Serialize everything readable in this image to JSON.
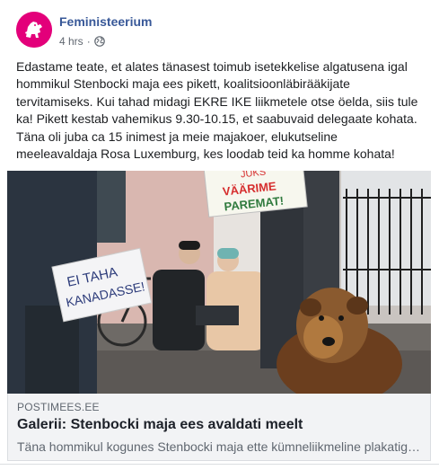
{
  "post": {
    "page_name": "Feministeerium",
    "time": "4 hrs",
    "separator": "·",
    "privacy_icon": "globe-icon",
    "text": "Edastame teate, et alates tänasest toimub isetekkelise algatusena igal hommikul Stenbocki maja ees pikett, koalitsioonläbirääkijate tervitamiseks. Kui tahad midagi EKRE IKE liikmetele otse öelda, siis tule ka! Pikett kestab vahemikus 9.30-10.15, et saabuvaid delegaate kohata. Täna oli juba ca 15 inimest ja meie majakoer, elukutseline meeleavaldaja Rosa Luxemburg, kes loodab teid ka homme kohata!"
  },
  "photo": {
    "sign_left": [
      "EI TAHA",
      "KANADASSE!"
    ],
    "sign_top": [
      "JUKS",
      "VÄÄRIME",
      "PAREMAT!"
    ]
  },
  "link": {
    "domain": "POSTIMEES.EE",
    "headline": "Galerii: Stenbocki maja ees avaldati meelt",
    "description": "Täna hommikul kogunes Stenbocki maja ette kümneliikmeline plakatiga meeleavaldajate seltskond"
  },
  "colors": {
    "brand": "#e3007a",
    "link_name": "#385898",
    "meta_gray": "#606770"
  }
}
